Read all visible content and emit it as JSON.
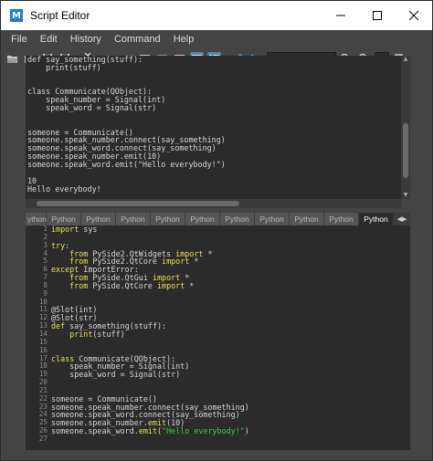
{
  "window": {
    "title": "Script Editor",
    "app_icon": "M"
  },
  "menu": [
    "File",
    "Edit",
    "History",
    "Command",
    "Help"
  ],
  "toolbar": {
    "icons": [
      "open-script-icon",
      "source-script-icon",
      "save-script-icon",
      "save-script-to-shelf-icon",
      "clear-history-icon",
      "clear-input-icon",
      "clear-all-icon",
      "show-history-icon",
      "show-input-icon",
      "show-both-icon",
      "show-tabs-icon",
      "echo-all-commands-icon",
      "execute-all-icon",
      "execute-icon"
    ],
    "search_value": "",
    "field_value": ""
  },
  "history": {
    "lines": [
      "def say_something(stuff):",
      "    print(stuff)",
      "",
      "",
      "class Communicate(QObject):",
      "    speak_number = Signal(int)",
      "    speak_word = Signal(str)",
      "",
      "",
      "someone = Communicate()",
      "someone.speak_number.connect(say_something)",
      "someone.speak_word.connect(say_something)",
      "someone.speak_number.emit(10)",
      "someone.speak_word.emit(\"Hello everybody!\")",
      "",
      "10",
      "Hello everybody!"
    ]
  },
  "tabs": [
    "ython",
    "Python",
    "Python",
    "Python",
    "Python",
    "Python",
    "Python",
    "Python",
    "Python",
    "Python",
    "Python"
  ],
  "active_tab": 10,
  "editor": {
    "lines": [
      [
        {
          "t": "import",
          "c": "kw"
        },
        {
          "t": " sys"
        }
      ],
      [
        {
          "t": ""
        }
      ],
      [
        {
          "t": "try",
          "c": "kw"
        },
        {
          "t": ":"
        }
      ],
      [
        {
          "t": "    "
        },
        {
          "t": "from",
          "c": "kw"
        },
        {
          "t": " PySide2.QtWidgets "
        },
        {
          "t": "import",
          "c": "kw"
        },
        {
          "t": " *"
        }
      ],
      [
        {
          "t": "    "
        },
        {
          "t": "from",
          "c": "kw"
        },
        {
          "t": " PySide2.QtCore "
        },
        {
          "t": "import",
          "c": "kw"
        },
        {
          "t": " *"
        }
      ],
      [
        {
          "t": "except",
          "c": "kw"
        },
        {
          "t": " ImportError:"
        }
      ],
      [
        {
          "t": "    "
        },
        {
          "t": "from",
          "c": "kw"
        },
        {
          "t": " PySide.QtGui "
        },
        {
          "t": "import",
          "c": "kw"
        },
        {
          "t": " *"
        }
      ],
      [
        {
          "t": "    "
        },
        {
          "t": "from",
          "c": "kw"
        },
        {
          "t": " PySide.QtCore "
        },
        {
          "t": "import",
          "c": "kw"
        },
        {
          "t": " *"
        }
      ],
      [
        {
          "t": ""
        }
      ],
      [
        {
          "t": ""
        }
      ],
      [
        {
          "t": "@Slot(int)"
        }
      ],
      [
        {
          "t": "@Slot(str)"
        }
      ],
      [
        {
          "t": "def",
          "c": "kw"
        },
        {
          "t": " say_something(stuff):"
        }
      ],
      [
        {
          "t": "    "
        },
        {
          "t": "print",
          "c": "kw"
        },
        {
          "t": "(stuff)"
        }
      ],
      [
        {
          "t": ""
        }
      ],
      [
        {
          "t": ""
        }
      ],
      [
        {
          "t": "class",
          "c": "kw"
        },
        {
          "t": " Communicate(QObject):"
        }
      ],
      [
        {
          "t": "    speak_number = Signal(int)"
        }
      ],
      [
        {
          "t": "    speak_word = Signal(str)"
        }
      ],
      [
        {
          "t": ""
        }
      ],
      [
        {
          "t": ""
        }
      ],
      [
        {
          "t": "someone = Communicate()"
        }
      ],
      [
        {
          "t": "someone.speak_number.connect(say_something)"
        }
      ],
      [
        {
          "t": "someone.speak_word.connect(say_something)"
        }
      ],
      [
        {
          "t": "someone.speak_number."
        },
        {
          "t": "emit",
          "c": "kw"
        },
        {
          "t": "(10)"
        }
      ],
      [
        {
          "t": "someone.speak_word."
        },
        {
          "t": "emit",
          "c": "kw"
        },
        {
          "t": "("
        },
        {
          "t": "\"Hello everybody!\"",
          "c": "fn"
        },
        {
          "t": ")"
        }
      ],
      [
        {
          "t": ""
        }
      ]
    ]
  }
}
